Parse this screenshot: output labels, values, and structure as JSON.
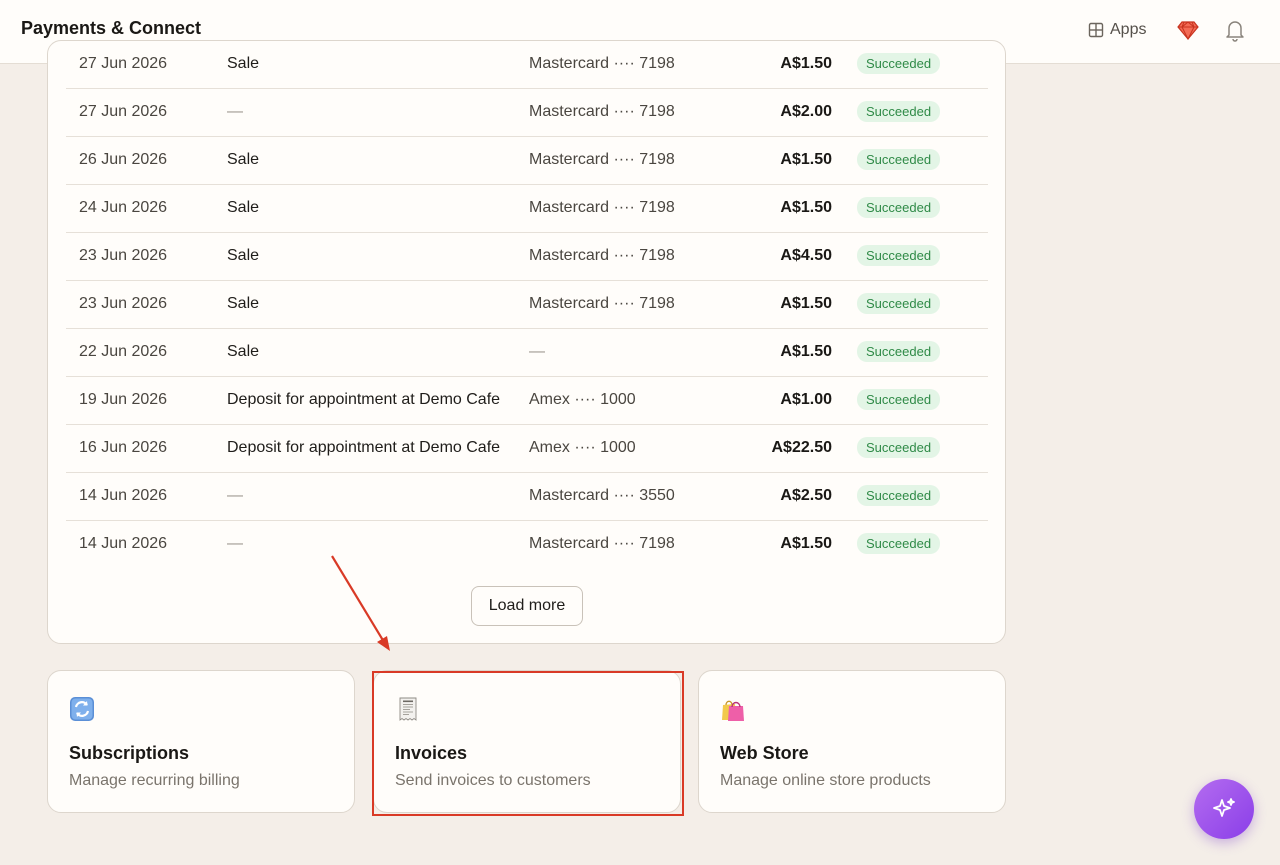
{
  "header": {
    "title": "Payments & Connect",
    "apps_label": "Apps"
  },
  "transactions": [
    {
      "date": "27 Jun 2026",
      "description": "Sale",
      "card": "Mastercard ···· 7198",
      "amount": "A$1.50",
      "status": "Succeeded"
    },
    {
      "date": "27 Jun 2026",
      "description": "—",
      "card": "Mastercard ···· 7198",
      "amount": "A$2.00",
      "status": "Succeeded"
    },
    {
      "date": "26 Jun 2026",
      "description": "Sale",
      "card": "Mastercard ···· 7198",
      "amount": "A$1.50",
      "status": "Succeeded"
    },
    {
      "date": "24 Jun 2026",
      "description": "Sale",
      "card": "Mastercard ···· 7198",
      "amount": "A$1.50",
      "status": "Succeeded"
    },
    {
      "date": "23 Jun 2026",
      "description": "Sale",
      "card": "Mastercard ···· 7198",
      "amount": "A$4.50",
      "status": "Succeeded"
    },
    {
      "date": "23 Jun 2026",
      "description": "Sale",
      "card": "Mastercard ···· 7198",
      "amount": "A$1.50",
      "status": "Succeeded"
    },
    {
      "date": "22 Jun 2026",
      "description": "Sale",
      "card": "—",
      "amount": "A$1.50",
      "status": "Succeeded"
    },
    {
      "date": "19 Jun 2026",
      "description": "Deposit for appointment at Demo Cafe",
      "card": "Amex ···· 1000",
      "amount": "A$1.00",
      "status": "Succeeded"
    },
    {
      "date": "16 Jun 2026",
      "description": "Deposit for appointment at Demo Cafe",
      "card": "Amex ···· 1000",
      "amount": "A$22.50",
      "status": "Succeeded"
    },
    {
      "date": "14 Jun 2026",
      "description": "—",
      "card": "Mastercard ···· 3550",
      "amount": "A$2.50",
      "status": "Succeeded"
    },
    {
      "date": "14 Jun 2026",
      "description": "—",
      "card": "Mastercard ···· 7198",
      "amount": "A$1.50",
      "status": "Succeeded"
    }
  ],
  "load_more_label": "Load more",
  "tiles": {
    "subscriptions": {
      "title": "Subscriptions",
      "description": "Manage recurring billing",
      "icon": "refresh-icon"
    },
    "invoices": {
      "title": "Invoices",
      "description": "Send invoices to customers",
      "icon": "receipt-icon"
    },
    "web_store": {
      "title": "Web Store",
      "description": "Manage online store products",
      "icon": "shopping-bags-icon"
    }
  },
  "colors": {
    "background": "#f4eee8",
    "status_badge_bg": "#e3f5e6",
    "status_badge_text": "#2f8a47",
    "highlight": "#d93a26",
    "fab_accent": "#9b50ec"
  }
}
